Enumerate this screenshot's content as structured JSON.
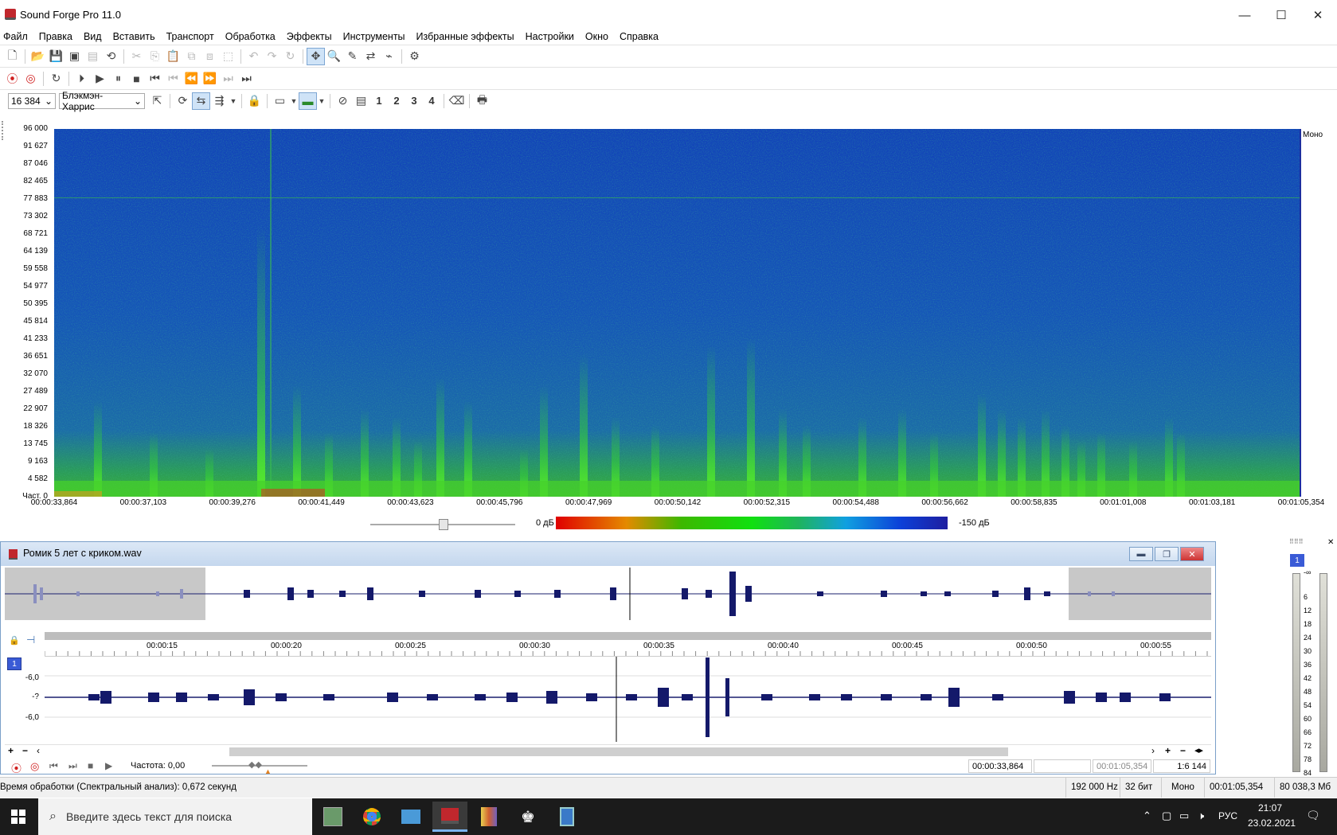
{
  "window": {
    "title": "Sound Forge Pro 11.0",
    "minimize": "—",
    "maximize": "☐",
    "close": "✕"
  },
  "menu": [
    "Файл",
    "Правка",
    "Вид",
    "Вставить",
    "Транспорт",
    "Обработка",
    "Эффекты",
    "Инструменты",
    "Избранные эффекты",
    "Настройки",
    "Окно",
    "Справка"
  ],
  "spectrum_toolbar": {
    "fft_size": "16 384",
    "window_function": "Блэкмэн-Харрис",
    "channels": [
      "1",
      "2",
      "3",
      "4"
    ]
  },
  "spectrogram": {
    "freq_labels": [
      "96 000",
      "91 627",
      "87 046",
      "82 465",
      "77 883",
      "73 302",
      "68 721",
      "64 139",
      "59 558",
      "54 977",
      "50 395",
      "45 814",
      "41 233",
      "36 651",
      "32 070",
      "27 489",
      "22 907",
      "18 326",
      "13 745",
      "9 163",
      "4 582",
      "Част. 0"
    ],
    "time_labels": [
      "00:00:33,864",
      "00:00:37,103",
      "00:00:39,276",
      "00:00:41,449",
      "00:00:43,623",
      "00:00:45,796",
      "00:00:47,969",
      "00:00:50,142",
      "00:00:52,315",
      "00:00:54,488",
      "00:00:56,662",
      "00:00:58,835",
      "00:01:01,008",
      "00:01:03,181",
      "00:01:05,354"
    ],
    "channel_mode": "Моно",
    "db_low": "0 дБ",
    "db_high": "-150 дБ"
  },
  "document": {
    "title": "Ромик 5 лет с криком.wav",
    "ruler_labels": [
      "00:00:15",
      "00:00:20",
      "00:00:25",
      "00:00:30",
      "00:00:35",
      "00:00:40",
      "00:00:45",
      "00:00:50",
      "00:00:55"
    ],
    "channel": "1",
    "level_labels": [
      "-6,0",
      "-?",
      "-6,0"
    ],
    "rate_label": "Частота: 0,00",
    "cursor_pos": "00:00:33,864",
    "length": "00:01:05,354",
    "zoom": "1:6 144"
  },
  "meter": {
    "channel": "1",
    "scale": [
      "-∞",
      "6",
      "12",
      "18",
      "24",
      "30",
      "36",
      "42",
      "48",
      "54",
      "60",
      "66",
      "72",
      "78",
      "84"
    ]
  },
  "status": {
    "message": "Время обработки (Спектральный анализ): 0,672 секунд",
    "sample_rate": "192 000 Hz",
    "bit_depth": "32 бит",
    "channels": "Моно",
    "length": "00:01:05,354",
    "free_space": "80 038,3 Мб"
  },
  "taskbar": {
    "search_placeholder": "Введите здесь текст для поиска",
    "lang": "РУС",
    "time": "21:07",
    "date": "23.02.2021"
  }
}
